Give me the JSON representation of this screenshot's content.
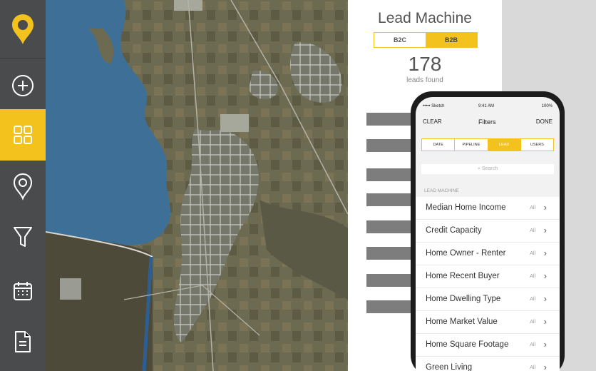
{
  "sidebar": {
    "logo": "pin-logo",
    "items": [
      {
        "icon": "plus-circle-icon"
      },
      {
        "icon": "grid-icon"
      },
      {
        "icon": "map-pin-icon"
      },
      {
        "icon": "filter-icon"
      },
      {
        "icon": "calendar-icon"
      },
      {
        "icon": "document-icon"
      }
    ]
  },
  "lead_panel": {
    "title": "Lead Machine",
    "toggle": [
      "B2C",
      "B2B"
    ],
    "count": "178",
    "count_label": "leads found"
  },
  "phone": {
    "status": {
      "carrier": "•••••  Sketch",
      "time": "9:41 AM",
      "battery": "100%"
    },
    "nav": {
      "left": "CLEAR",
      "title": "Filters",
      "right": "DONE"
    },
    "tabs": [
      "DATE",
      "PIPELINE",
      "LEAD",
      "USERS"
    ],
    "search_placeholder": "Search",
    "section_label": "LEAD MACHINE",
    "rows": [
      {
        "label": "Median Home Income",
        "value": "All"
      },
      {
        "label": "Credit Capacity",
        "value": "All"
      },
      {
        "label": "Home Owner - Renter",
        "value": "All"
      },
      {
        "label": "Home Recent Buyer",
        "value": "All"
      },
      {
        "label": "Home Dwelling Type",
        "value": "All"
      },
      {
        "label": "Home Market Value",
        "value": "All"
      },
      {
        "label": "Home Square Footage",
        "value": "All"
      },
      {
        "label": "Green Living",
        "value": "All"
      }
    ]
  },
  "colors": {
    "accent": "#f3c21d",
    "sidebar": "#4a4b4d",
    "water": "#3e6f96"
  }
}
